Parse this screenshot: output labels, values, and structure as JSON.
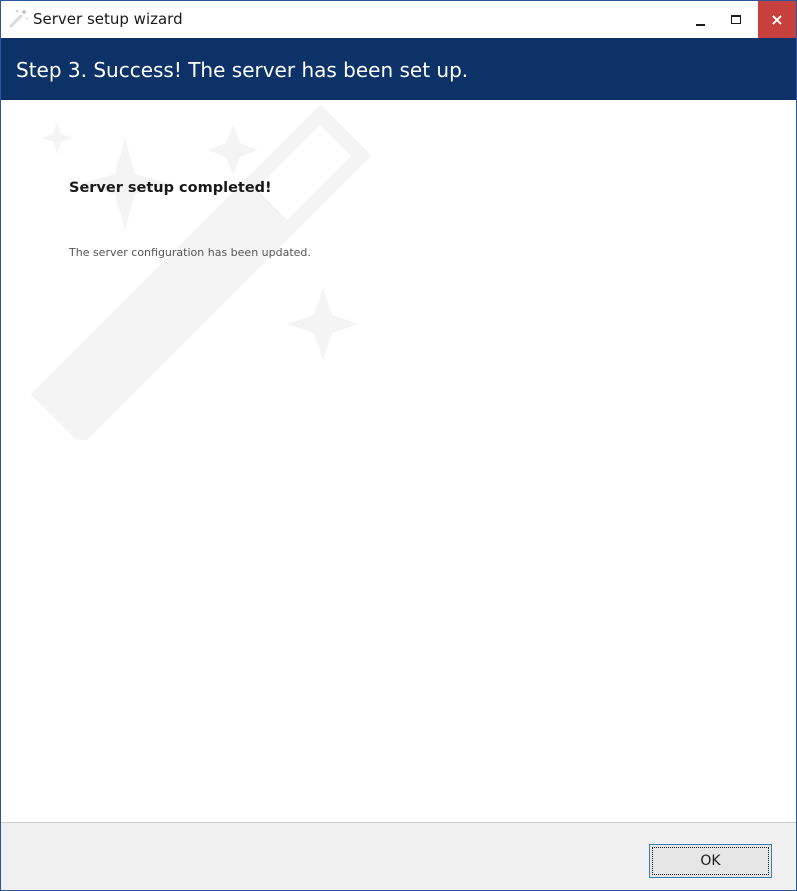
{
  "window": {
    "title": "Server setup wizard",
    "controls": {
      "minimize_icon": "minimize-icon",
      "maximize_icon": "maximize-icon",
      "close_icon": "close-icon",
      "close_glyph": "×"
    }
  },
  "header": {
    "step_title": "Step 3. Success! The server has been set up."
  },
  "content": {
    "heading": "Server setup completed!",
    "message": "The server configuration has been updated."
  },
  "footer": {
    "ok_label": "OK"
  },
  "colors": {
    "header_background": "#0c3268",
    "close_button": "#c7403e",
    "window_border": "#2b579a",
    "footer_background": "#f0f0f0"
  }
}
